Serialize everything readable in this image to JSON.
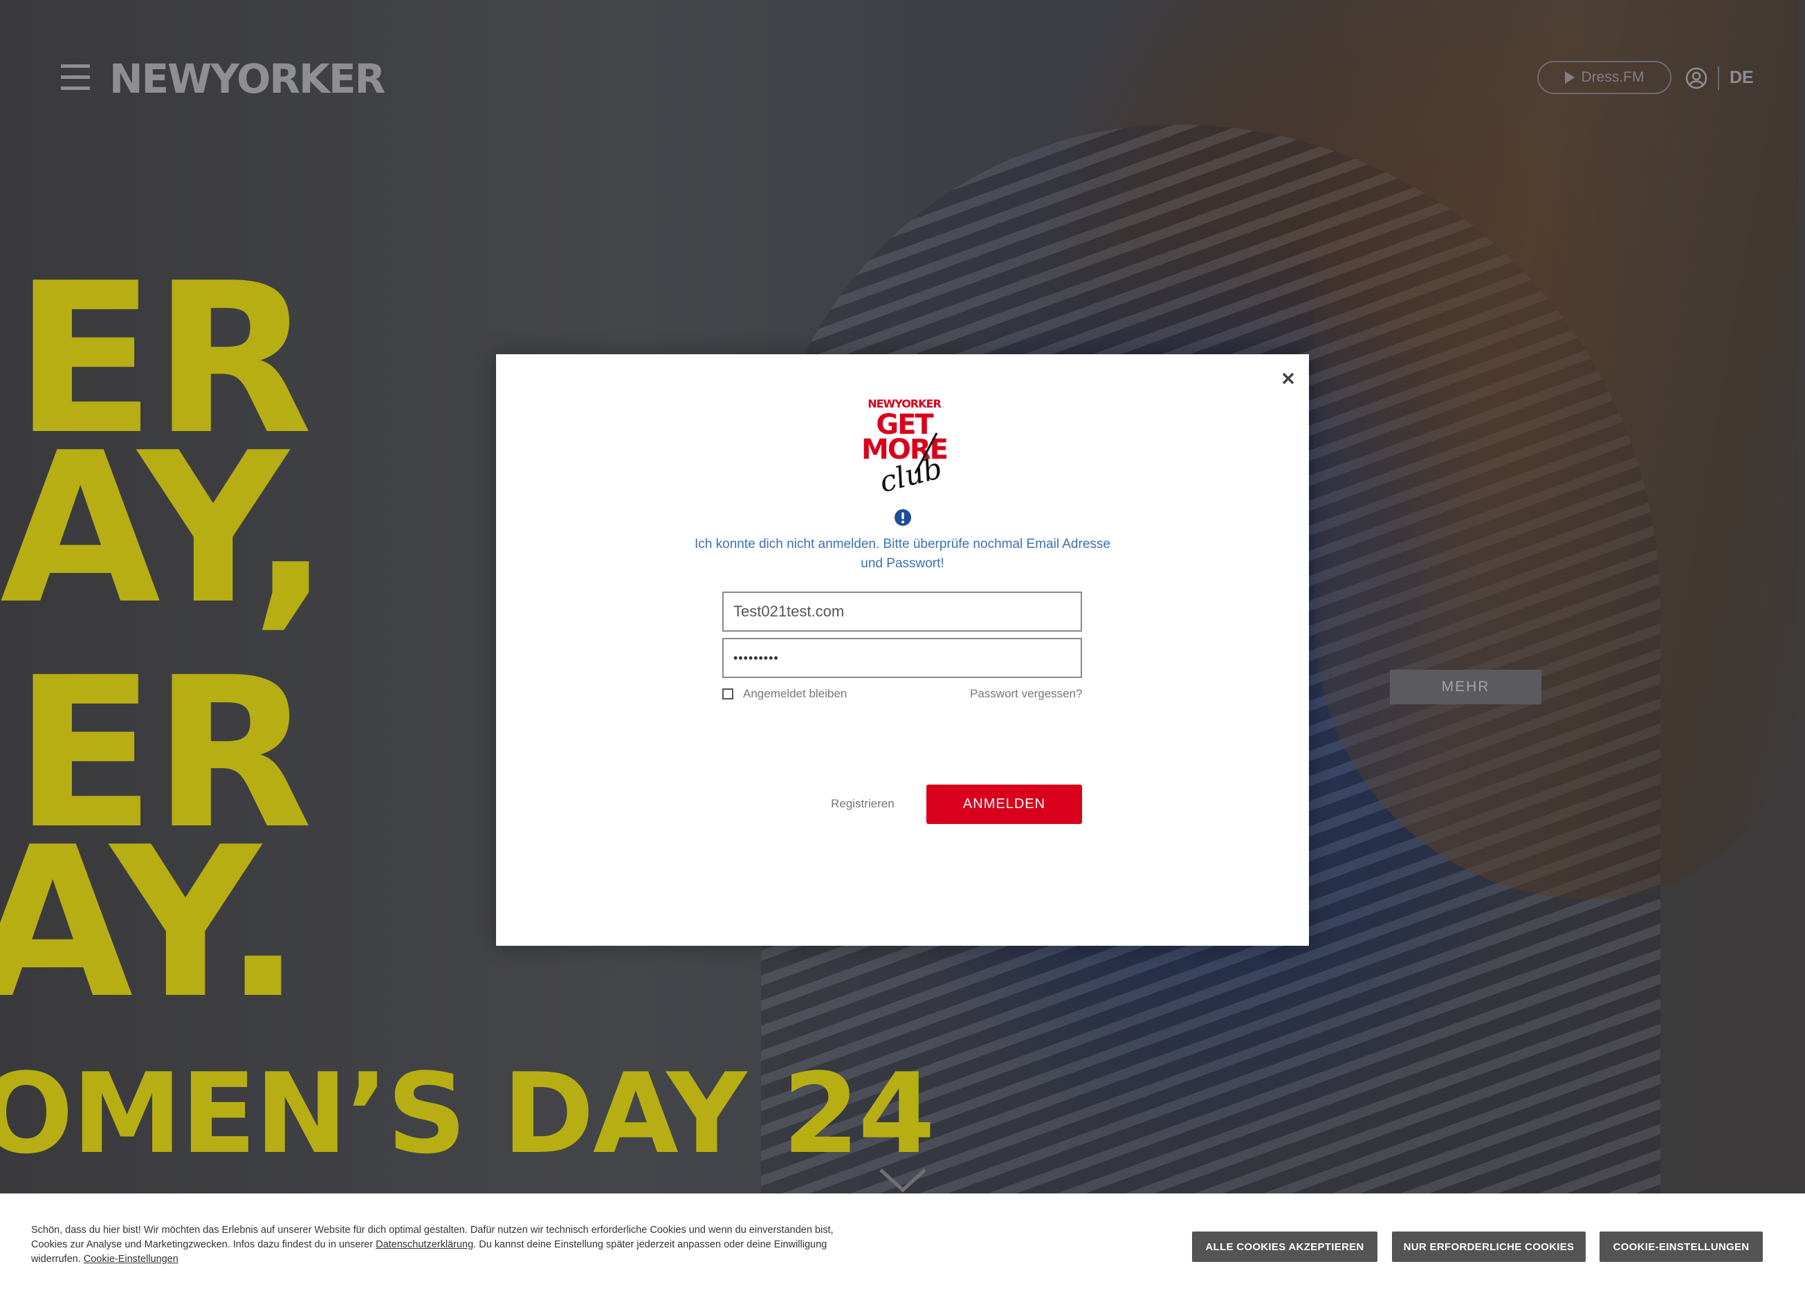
{
  "hero": {
    "line1": "ER",
    "line2": "AY,",
    "line3": "ER",
    "line4": "AY.",
    "line5": "OMEN’S DAY 24",
    "mehr_label": "MEHR"
  },
  "header": {
    "logo": "NEWYORKER",
    "dressfm_label": "Dress.FM",
    "language": "DE"
  },
  "modal": {
    "brand": "NEWYORKER",
    "club_line1": "GET",
    "club_line2": "MORE",
    "club_line3": "club",
    "error_message": "Ich konnte dich nicht anmelden. Bitte überprüfe nochmal Email Adresse und Passwort!",
    "email_value": "Test021test.com",
    "password_value": "•••••••••",
    "remember_label": "Angemeldet bleiben",
    "forgot_label": "Passwort vergessen?",
    "register_label": "Registrieren",
    "login_label": "ANMELDEN"
  },
  "cookie": {
    "text_part1": "Schön, dass du hier bist! Wir möchten das Erlebnis auf unserer Website für dich optimal gestalten. Dafür nutzen wir technisch erforderliche Cookies und wenn du einverstanden bist, Cookies zur Analyse und Marketingzwecken. Infos dazu findest du in unserer ",
    "privacy_link": "Datenschutzerklärung",
    "text_part2": ". Du kannst deine Einstellung später jederzeit anpassen oder deine Einwilligung widerrufen. ",
    "settings_link": "Cookie-Einstellungen",
    "accept_all": "ALLE COOKIES AKZEPTIEREN",
    "only_required": "NUR ERFORDERLICHE COOKIES",
    "settings_button": "COOKIE-EINSTELLUNGEN"
  },
  "colors": {
    "accent_red": "#d9001b",
    "error_blue": "#3d6fb6",
    "hero_yellow": "#b7ae14",
    "cookie_button": "#545454"
  },
  "icons": [
    "menu-icon",
    "play-icon",
    "user-icon",
    "close-icon",
    "alert-icon",
    "chevron-down-icon"
  ]
}
